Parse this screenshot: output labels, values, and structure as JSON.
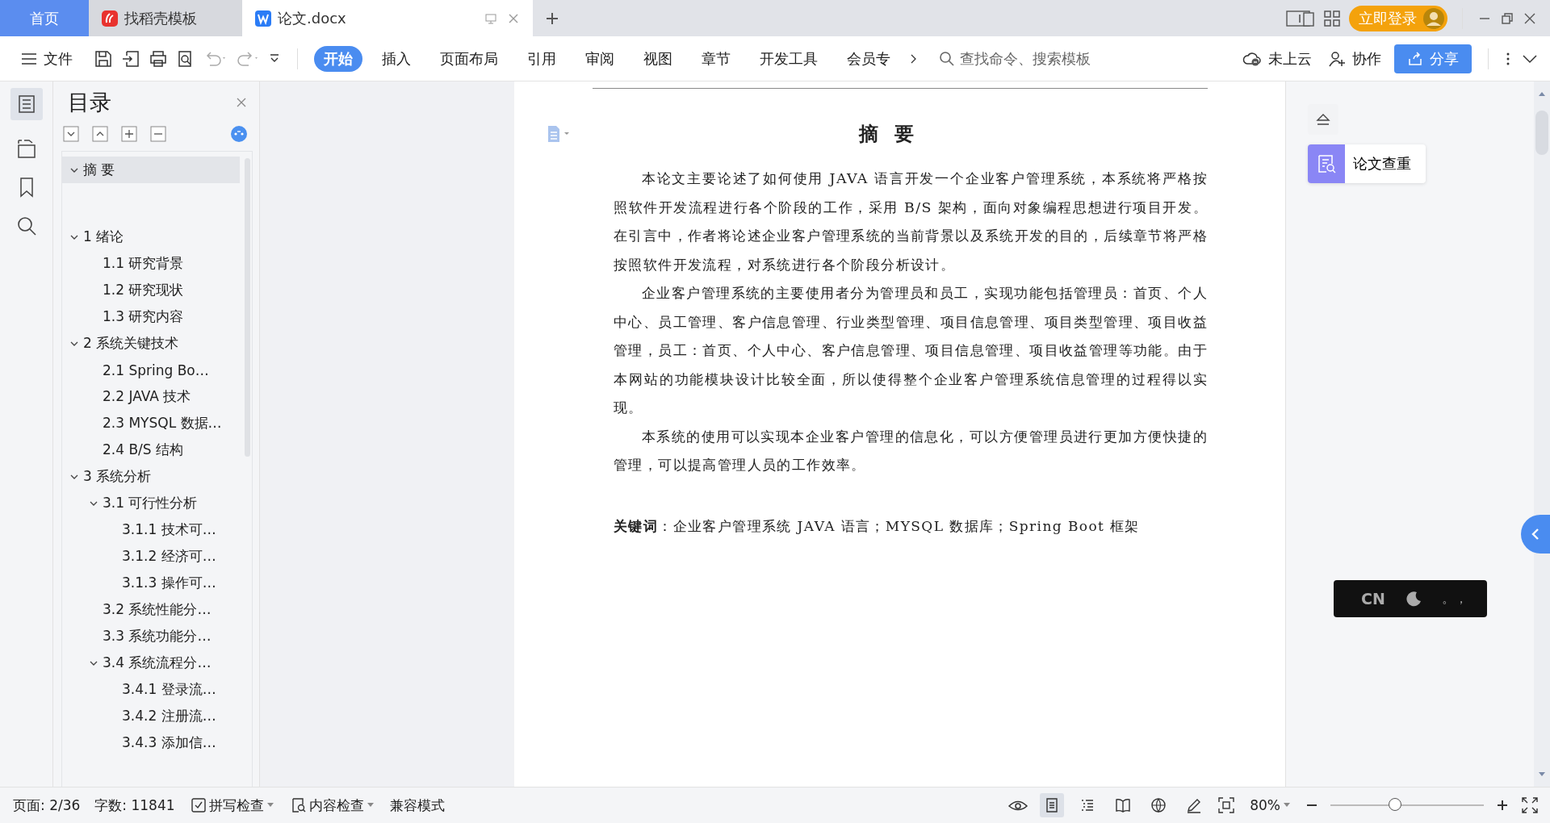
{
  "tabs": [
    {
      "label": "首页",
      "kind": "home",
      "selected": false
    },
    {
      "label": "找稻壳模板",
      "kind": "docer",
      "selected": false
    },
    {
      "label": "论文.docx",
      "kind": "doc",
      "selected": true
    }
  ],
  "login": {
    "label": "立即登录"
  },
  "menu": {
    "file": "文件",
    "tabs": [
      {
        "label": "开始",
        "selected": true
      },
      {
        "label": "插入",
        "selected": false
      },
      {
        "label": "页面布局",
        "selected": false
      },
      {
        "label": "引用",
        "selected": false
      },
      {
        "label": "审阅",
        "selected": false
      },
      {
        "label": "视图",
        "selected": false
      },
      {
        "label": "章节",
        "selected": false
      },
      {
        "label": "开发工具",
        "selected": false
      },
      {
        "label": "会员专",
        "selected": false
      }
    ],
    "search": {
      "placeholder": "查找命令、搜索模板"
    },
    "cloud": "未上云",
    "collab": "协作",
    "share": "分享"
  },
  "toc": {
    "title": "目录",
    "items": [
      {
        "label": "摘 要",
        "selected": true,
        "expanded": true
      },
      {
        "label": "1  绪论",
        "selected": false,
        "expanded": true,
        "children": [
          {
            "label": "1.1 研究背景",
            "selected": false
          },
          {
            "label": "1.2 研究现状",
            "selected": false
          },
          {
            "label": "1.3 研究内容",
            "selected": false
          }
        ]
      },
      {
        "label": "2  系统关键技术",
        "selected": false,
        "expanded": true,
        "children": [
          {
            "label": "2.1 Spring   Bo…",
            "selected": false
          },
          {
            "label": "2.2 JAVA 技术",
            "selected": false
          },
          {
            "label": "2.3 MYSQL 数据…",
            "selected": false
          },
          {
            "label": "2.4 B/S 结构",
            "selected": false
          }
        ]
      },
      {
        "label": "3  系统分析",
        "selected": false,
        "expanded": true,
        "children": [
          {
            "label": "3.1  可行性分析",
            "selected": false,
            "expanded": true,
            "children": [
              {
                "label": "3.1.1  技术可…",
                "selected": false
              },
              {
                "label": "3.1.2 经济可…",
                "selected": false
              },
              {
                "label": "3.1.3 操作可…",
                "selected": false
              }
            ]
          },
          {
            "label": "3.2  系统性能分…",
            "selected": false
          },
          {
            "label": "3.3  系统功能分…",
            "selected": false
          },
          {
            "label": "3.4 系统流程分…",
            "selected": false,
            "expanded": true,
            "children": [
              {
                "label": "3.4.1 登录流…",
                "selected": false
              },
              {
                "label": "3.4.2 注册流…",
                "selected": false
              },
              {
                "label": "3.4.3 添加信…",
                "selected": false
              }
            ]
          }
        ]
      }
    ]
  },
  "document": {
    "heading": "摘 要",
    "paragraphs": [
      "本论文主要论述了如何使用 JAVA 语言开发一个企业客户管理系统，本系统将严格按照软件开发流程进行各个阶段的工作，采用 B/S 架构，面向对象编程思想进行项目开发。在引言中，作者将论述企业客户管理系统的当前背景以及系统开发的目的，后续章节将严格按照软件开发流程，对系统进行各个阶段分析设计。",
      "企业客户管理系统的主要使用者分为管理员和员工，实现功能包括管理员：首页、个人中心、员工管理、客户信息管理、行业类型管理、项目信息管理、项目类型管理、项目收益管理，员工：首页、个人中心、客户信息管理、项目信息管理、项目收益管理等功能。由于本网站的功能模块设计比较全面，所以使得整个企业客户管理系统信息管理的过程得以实现。",
      "本系统的使用可以实现本企业客户管理的信息化，可以方便管理员进行更加方便快捷的管理，可以提高管理人员的工作效率。"
    ],
    "keywords": "**关键词**：企业客户管理系统 JAVA 语言；MYSQL 数据库；Spring  Boot 框架"
  },
  "side_panel": {
    "check": "论文查重"
  },
  "ime": {
    "mode": "CN",
    "punct": "。，"
  },
  "status_bar": {
    "page": "页面: 2/36",
    "words": "字数: 11841",
    "spell": "拼写检查",
    "content": "内容检查",
    "compat": "兼容模式",
    "views": [
      {
        "kind": "page",
        "selected": true
      },
      {
        "kind": "outline",
        "selected": false
      },
      {
        "kind": "read",
        "selected": false
      },
      {
        "kind": "web",
        "selected": false
      },
      {
        "kind": "pen",
        "selected": false
      }
    ],
    "zoom": "80%",
    "zoom_slider": {
      "level": 0.42
    }
  }
}
